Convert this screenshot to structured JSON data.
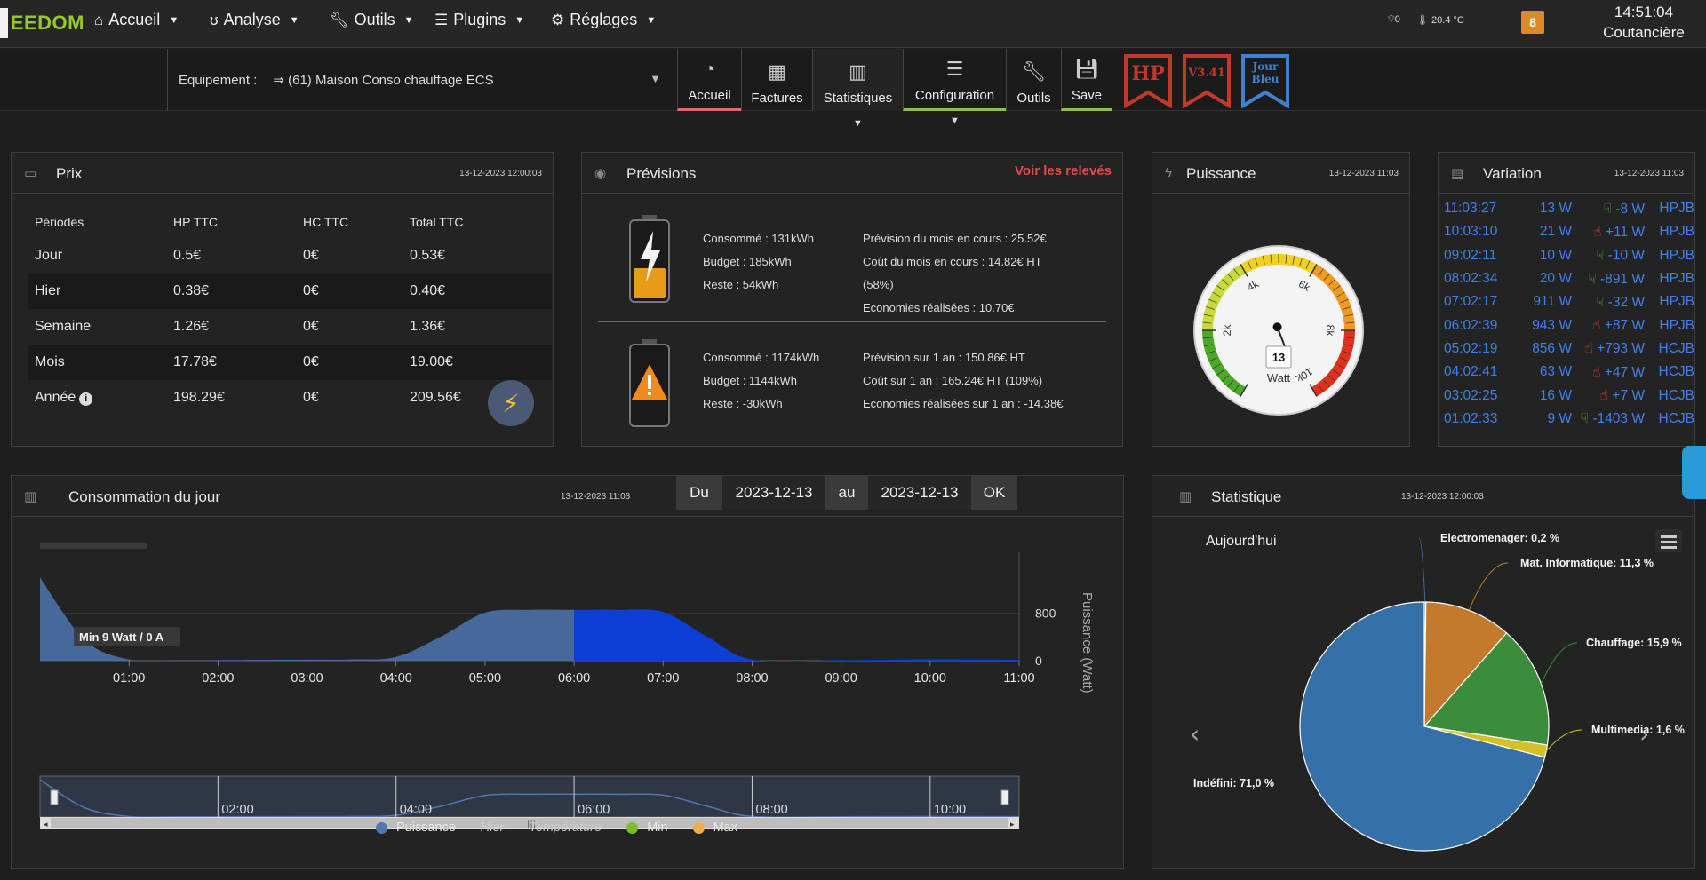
{
  "nav": {
    "logo_text": "EEDOM",
    "items": [
      {
        "label": "Accueil",
        "icon": "home-icon"
      },
      {
        "label": "Analyse",
        "icon": "stethoscope-icon"
      },
      {
        "label": "Outils",
        "icon": "wrench-icon"
      },
      {
        "label": "Plugins",
        "icon": "list-icon"
      },
      {
        "label": "Réglages",
        "icon": "gear-icon"
      }
    ],
    "sensor1": "0",
    "sensor2": "20.4 °C",
    "badge": "8",
    "time": "14:51:04",
    "location": "Coutancière"
  },
  "subbar": {
    "equip_label": "Equipement :",
    "equip_value": "⇒ (61) Maison Conso chauffage ECS",
    "tabs": [
      "Accueil",
      "Factures",
      "Statistiques",
      "Configuration",
      "Outils",
      "Save"
    ],
    "ribbons": [
      {
        "text": "HP",
        "color": "#c0392b"
      },
      {
        "text": "V3.41",
        "color": "#c0392b"
      },
      {
        "text1": "Jour",
        "text2": "Bleu",
        "color": "#3f7fd0"
      }
    ]
  },
  "prix": {
    "title": "Prix",
    "date": "13-12-2023 12:00:03",
    "headers": [
      "Périodes",
      "HP TTC",
      "HC TTC",
      "Total TTC"
    ],
    "rows": [
      [
        "Jour",
        "0.5€",
        "0€",
        "0.53€"
      ],
      [
        "Hier",
        "0.38€",
        "0€",
        "0.40€"
      ],
      [
        "Semaine",
        "1.26€",
        "0€",
        "1.36€"
      ],
      [
        "Mois",
        "17.78€",
        "0€",
        "19.00€"
      ],
      [
        "Année",
        "198.29€",
        "0€",
        "209.56€"
      ]
    ]
  },
  "previsions": {
    "title": "Prévisions",
    "link": "Voir les relevés",
    "month": {
      "consomme": "Consommé : 131kWh",
      "budget": "Budget : 185kWh",
      "reste": "Reste : 54kWh",
      "prevision": "Prévision du mois en cours : 25.52€",
      "cout": "Coût du mois en cours : 14.82€ HT",
      "pct": "(58%)",
      "eco": "Economies réalisées : 10.70€"
    },
    "year": {
      "consomme": "Consommé : 1174kWh",
      "budget": "Budget : 1144kWh",
      "reste": "Reste : -30kWh",
      "prevision": "Prévision sur 1 an : 150.86€ HT",
      "cout": "Coût sur 1 an : 165.24€ HT (109%)",
      "eco": "Economies réalisées sur 1 an : -14.38€"
    }
  },
  "puissance": {
    "title": "Puissance",
    "date": "13-12-2023 11:03",
    "value": 13,
    "unit": "Watt",
    "max": 10000,
    "ticks": [
      "2k",
      "4k",
      "6k",
      "8k",
      "10k"
    ]
  },
  "variation": {
    "title": "Variation",
    "date": "13-12-2023 11:03",
    "rows": [
      {
        "t": "11:03:27",
        "w": "13 W",
        "dir": "down",
        "d": "-8 W",
        "p": "HPJB"
      },
      {
        "t": "10:03:10",
        "w": "21 W",
        "dir": "up",
        "d": "+11 W",
        "p": "HPJB"
      },
      {
        "t": "09:02:11",
        "w": "10 W",
        "dir": "down",
        "d": "-10 W",
        "p": "HPJB"
      },
      {
        "t": "08:02:34",
        "w": "20 W",
        "dir": "down",
        "d": "-891 W",
        "p": "HPJB"
      },
      {
        "t": "07:02:17",
        "w": "911 W",
        "dir": "down",
        "d": "-32 W",
        "p": "HPJB"
      },
      {
        "t": "06:02:39",
        "w": "943 W",
        "dir": "up",
        "d": "+87 W",
        "p": "HPJB"
      },
      {
        "t": "05:02:19",
        "w": "856 W",
        "dir": "up",
        "d": "+793 W",
        "p": "HCJB"
      },
      {
        "t": "04:02:41",
        "w": "63 W",
        "dir": "up",
        "d": "+47 W",
        "p": "HCJB"
      },
      {
        "t": "03:02:25",
        "w": "16 W",
        "dir": "up",
        "d": "+7 W",
        "p": "HCJB"
      },
      {
        "t": "01:02:33",
        "w": "9 W",
        "dir": "down",
        "d": "-1403 W",
        "p": "HCJB"
      }
    ]
  },
  "conso": {
    "title": "Consommation du jour",
    "date": "13-12-2023 11:03",
    "du": "Du",
    "from": "2023-12-13",
    "au": "au",
    "to": "2023-12-13",
    "ok": "OK",
    "min_label": "Min 9 Watt / 0 A",
    "legend": [
      {
        "name": "Puissance",
        "color": "#4f76b0",
        "italic": false
      },
      {
        "name": "Hier",
        "color": "",
        "italic": true
      },
      {
        "name": "Température",
        "color": "",
        "italic": true
      },
      {
        "name": "Min",
        "color": "#7cbe2d",
        "italic": false
      },
      {
        "name": "Max",
        "color": "#f0ad4e",
        "italic": false
      }
    ]
  },
  "chart_data": {
    "type": "area",
    "x": [
      "00:00",
      "00:30",
      "01:00",
      "01:30",
      "02:00",
      "03:00",
      "03:30",
      "04:00",
      "04:30",
      "05:00",
      "05:30",
      "06:00",
      "06:30",
      "07:00",
      "07:30",
      "08:00",
      "09:00",
      "10:00",
      "11:00"
    ],
    "series": [
      {
        "name": "Puissance",
        "values": [
          1400,
          350,
          20,
          10,
          10,
          16,
          20,
          63,
          400,
          810,
          856,
          856,
          856,
          820,
          400,
          20,
          10,
          20,
          13
        ]
      }
    ],
    "xticks": [
      "01:00",
      "02:00",
      "03:00",
      "04:00",
      "05:00",
      "06:00",
      "07:00",
      "08:00",
      "09:00",
      "10:00",
      "11:00"
    ],
    "navticks": [
      "02:00",
      "04:00",
      "06:00",
      "08:00",
      "10:00"
    ],
    "ylabel": "Puissance (Watt)",
    "yticks": [
      0,
      800
    ],
    "ylim": [
      0,
      1900
    ]
  },
  "stat_data": {
    "type": "pie",
    "title": "Statistique",
    "date": "13-12-2023 12:00:03",
    "subtitle": "Aujourd'hui",
    "slices": [
      {
        "name": "Electromenager",
        "value": 0.2,
        "color": "#3b6d9e",
        "label": "Electromenager: 0,2 %"
      },
      {
        "name": "Mat. Informatique",
        "value": 11.3,
        "color": "#c47a2c",
        "label": "Mat. Informatique: 11,3 %"
      },
      {
        "name": "Chauffage",
        "value": 15.9,
        "color": "#3b8c3b",
        "label": "Chauffage: 15,9 %"
      },
      {
        "name": "Multimedia",
        "value": 1.6,
        "color": "#d4c02a",
        "label": "Multimedia: 1,6 %"
      },
      {
        "name": "Indéfini",
        "value": 71.0,
        "color": "#3670a8",
        "label": "Indéfini: 71,0 %"
      }
    ]
  }
}
